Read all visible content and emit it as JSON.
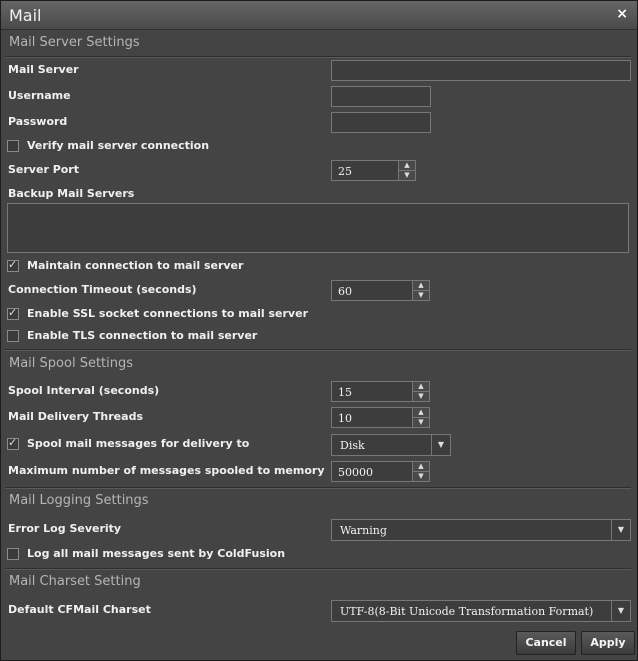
{
  "window": {
    "title": "Mail",
    "close_glyph": "×"
  },
  "sections": {
    "server": "Mail Server Settings",
    "spool": "Mail Spool Settings",
    "logging": "Mail Logging Settings",
    "charset": "Mail Charset Setting"
  },
  "server": {
    "mail_server_label": "Mail Server",
    "mail_server_value": "",
    "username_label": "Username",
    "username_value": "",
    "password_label": "Password",
    "password_value": "",
    "verify_label": "Verify mail server connection",
    "verify_checked": false,
    "port_label": "Server Port",
    "port_value": "25",
    "backup_label": "Backup Mail Servers",
    "backup_value": "",
    "maintain_label": "Maintain connection to mail server",
    "maintain_checked": true,
    "timeout_label": "Connection Timeout (seconds)",
    "timeout_value": "60",
    "ssl_label": "Enable SSL socket connections to mail server",
    "ssl_checked": true,
    "tls_label": "Enable TLS connection to mail server",
    "tls_checked": false
  },
  "spool": {
    "interval_label": "Spool Interval (seconds)",
    "interval_value": "15",
    "threads_label": "Mail Delivery Threads",
    "threads_value": "10",
    "spool_to_label": "Spool mail messages for delivery to",
    "spool_to_checked": true,
    "spool_to_value": "Disk",
    "max_label": "Maximum number of messages spooled to memory",
    "max_value": "50000"
  },
  "logging": {
    "severity_label": "Error Log Severity",
    "severity_value": "Warning",
    "log_all_label": "Log all mail messages sent by ColdFusion",
    "log_all_checked": false
  },
  "charset": {
    "label": "Default CFMail Charset",
    "value": "UTF-8(8-Bit Unicode Transformation Format)"
  },
  "buttons": {
    "cancel": "Cancel",
    "apply": "Apply"
  },
  "icons": {
    "check": "✓",
    "spin_up": "▲",
    "spin_down": "▼",
    "dropdown": "▼"
  }
}
